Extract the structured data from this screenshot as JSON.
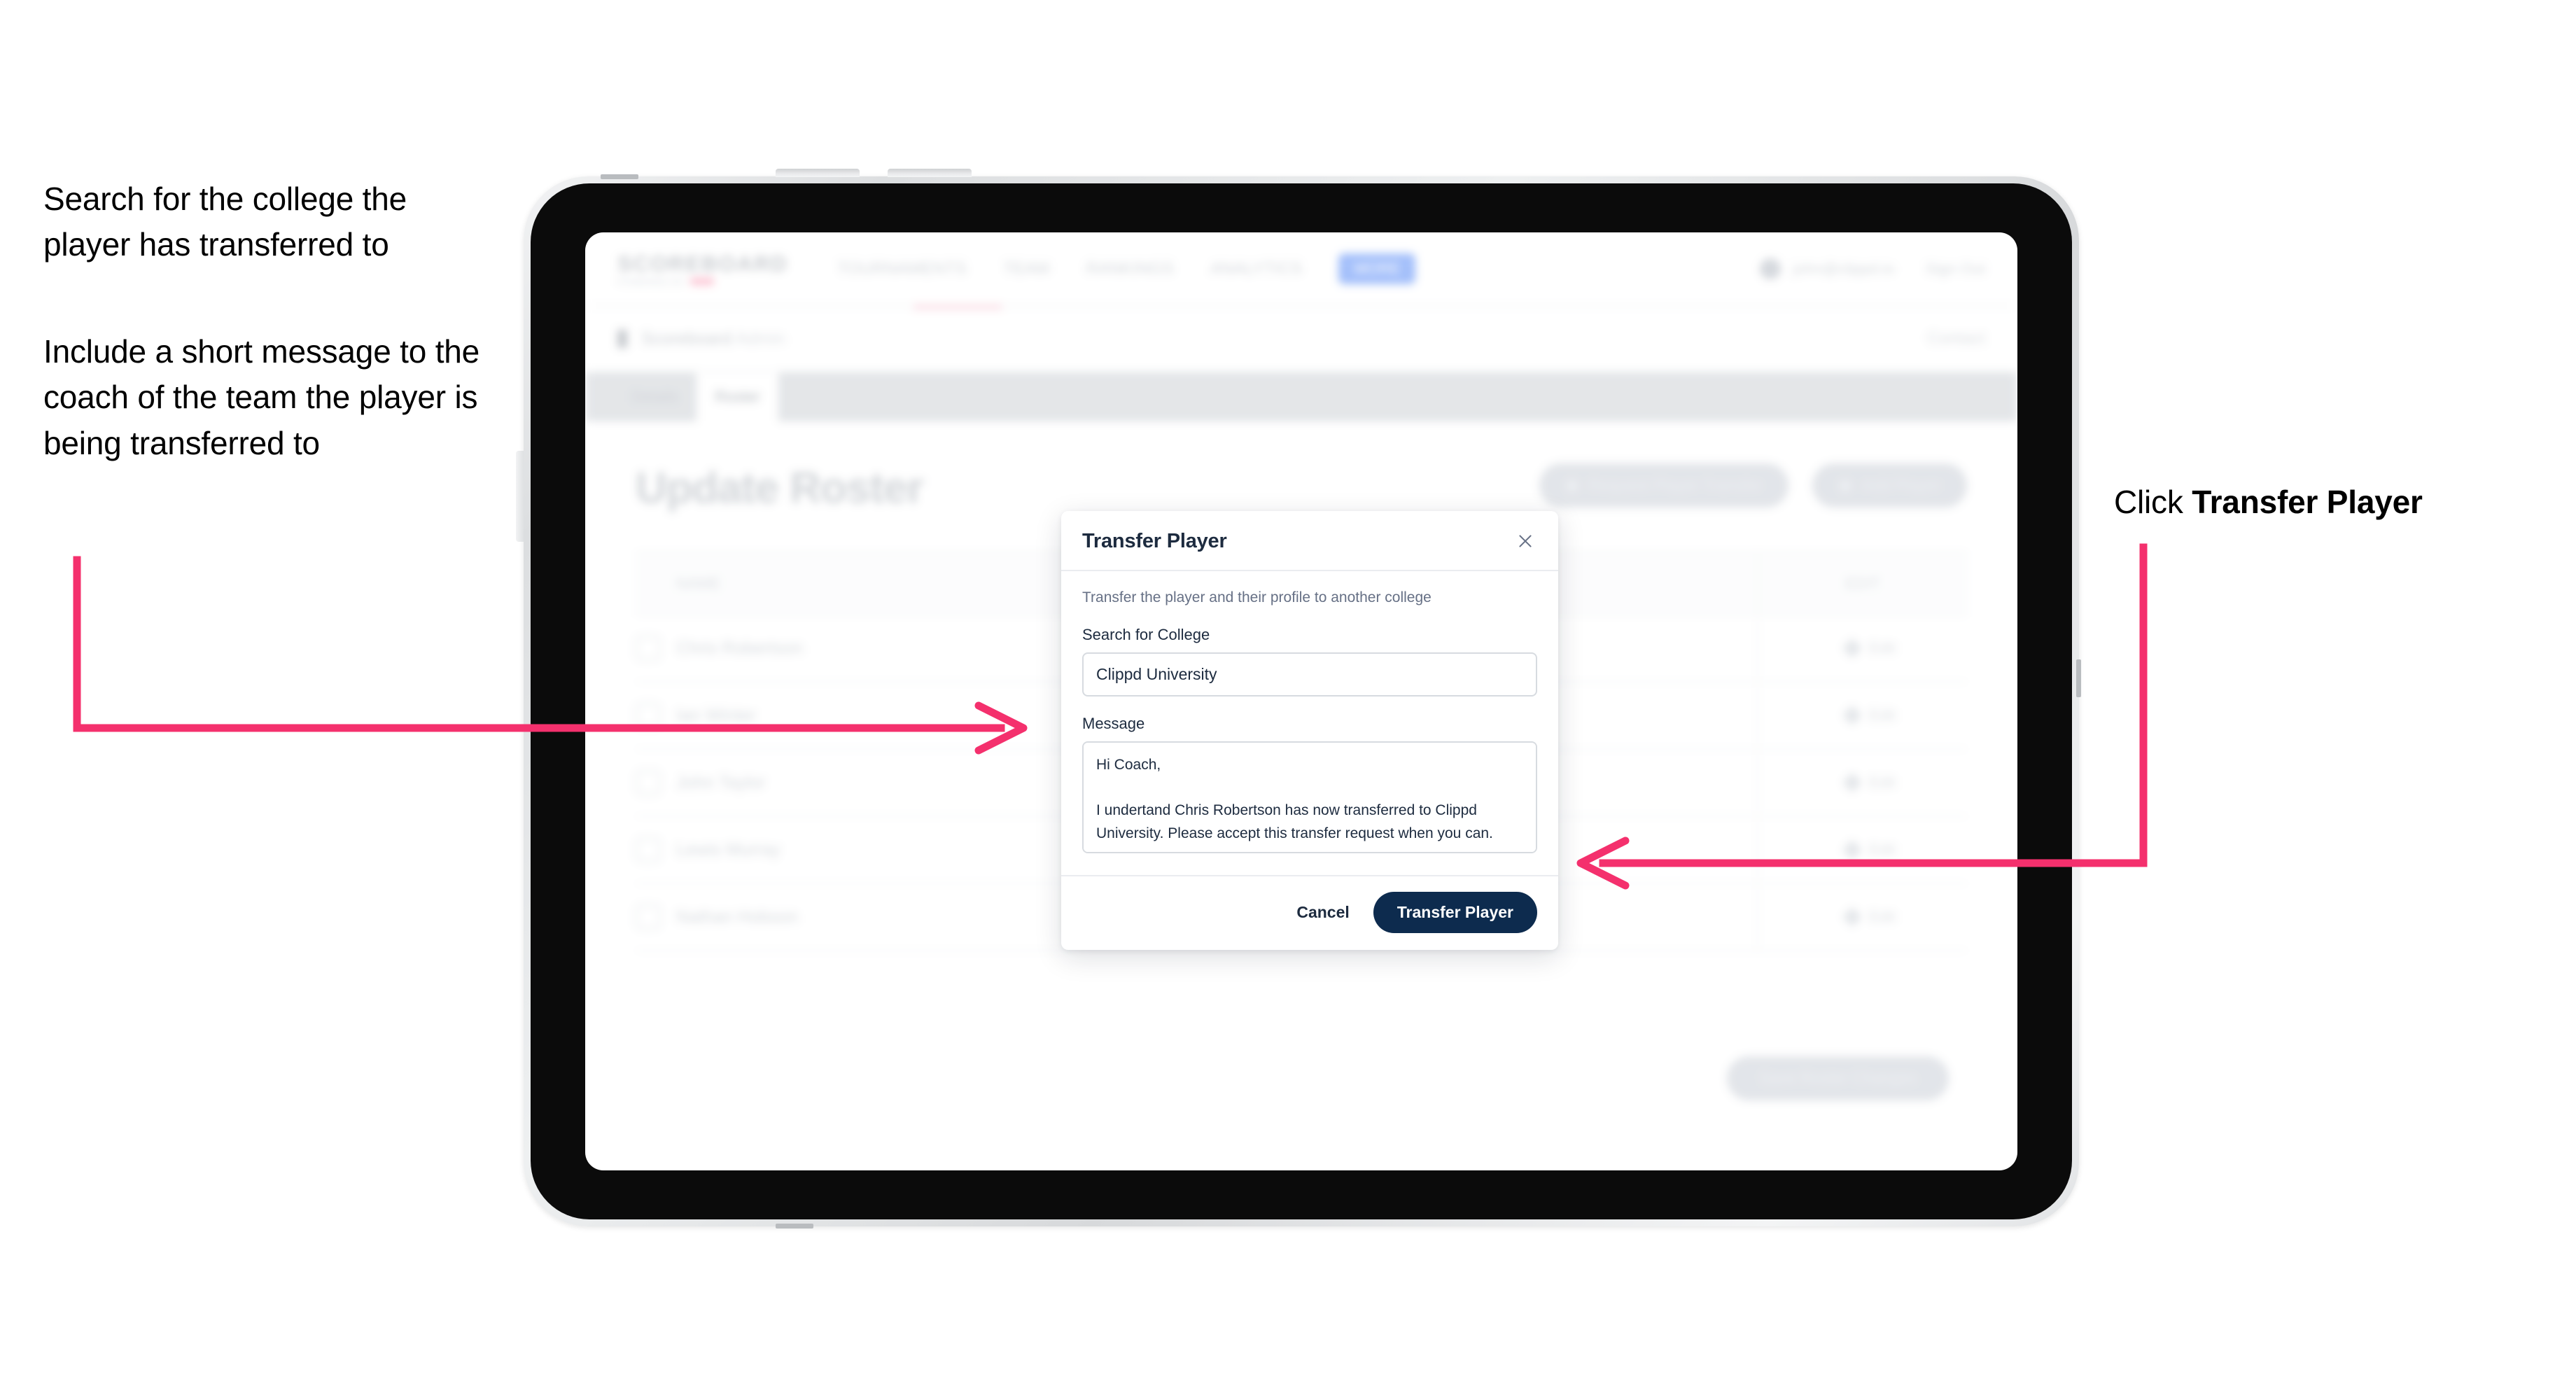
{
  "annotations": {
    "left_1": "Search for the college the player has transferred to",
    "left_2": "Include a short message to the coach of the team the player is being transferred to",
    "right_1_prefix": "Click ",
    "right_1_bold": "Transfer Player"
  },
  "colors": {
    "annotation_arrow": "#f4306d",
    "primary_button": "#0d2b4e",
    "brand_accent": "#f73c6e",
    "nav_pill": "#5b8df7"
  },
  "app": {
    "brand": {
      "name": "SCOREBOARD",
      "sub": "POWERED BY"
    },
    "nav": {
      "links": [
        "TOURNAMENTS",
        "TEAM",
        "RANKINGS",
        "ANALYTICS"
      ],
      "pill": "MORE",
      "user": "john@clippd.io",
      "signout": "Sign Out"
    },
    "breadcrumb": {
      "text": "Scoreboard",
      "sub": "Admin",
      "right": "Contact"
    },
    "tabs": [
      {
        "label": "Details",
        "active": false
      },
      {
        "label": "Roster",
        "active": true
      }
    ],
    "page_title": "Update Roster",
    "header_buttons": [
      "Request Player Transfer",
      "Add Player"
    ],
    "table": {
      "headers": {
        "name": "NAME",
        "edit": "EDIT"
      },
      "rows": [
        {
          "name": "Chris Robertson",
          "edit": "Edit"
        },
        {
          "name": "Ian Winter",
          "edit": "Edit"
        },
        {
          "name": "John Taylor",
          "edit": "Edit"
        },
        {
          "name": "Lewis Murray",
          "edit": "Edit"
        },
        {
          "name": "Nathan Hobson",
          "edit": "Edit"
        }
      ]
    },
    "save_button": "Save Roster Changes"
  },
  "modal": {
    "title": "Transfer Player",
    "close_icon": "close-icon",
    "description": "Transfer the player and their profile to another college",
    "college_field": {
      "label": "Search for College",
      "value": "Clippd University",
      "placeholder": "Search for College"
    },
    "message_field": {
      "label": "Message",
      "value": "Hi Coach,\n\nI undertand Chris Robertson has now transferred to Clippd University. Please accept this transfer request when you can.",
      "placeholder": "Message"
    },
    "cancel_label": "Cancel",
    "submit_label": "Transfer Player"
  }
}
